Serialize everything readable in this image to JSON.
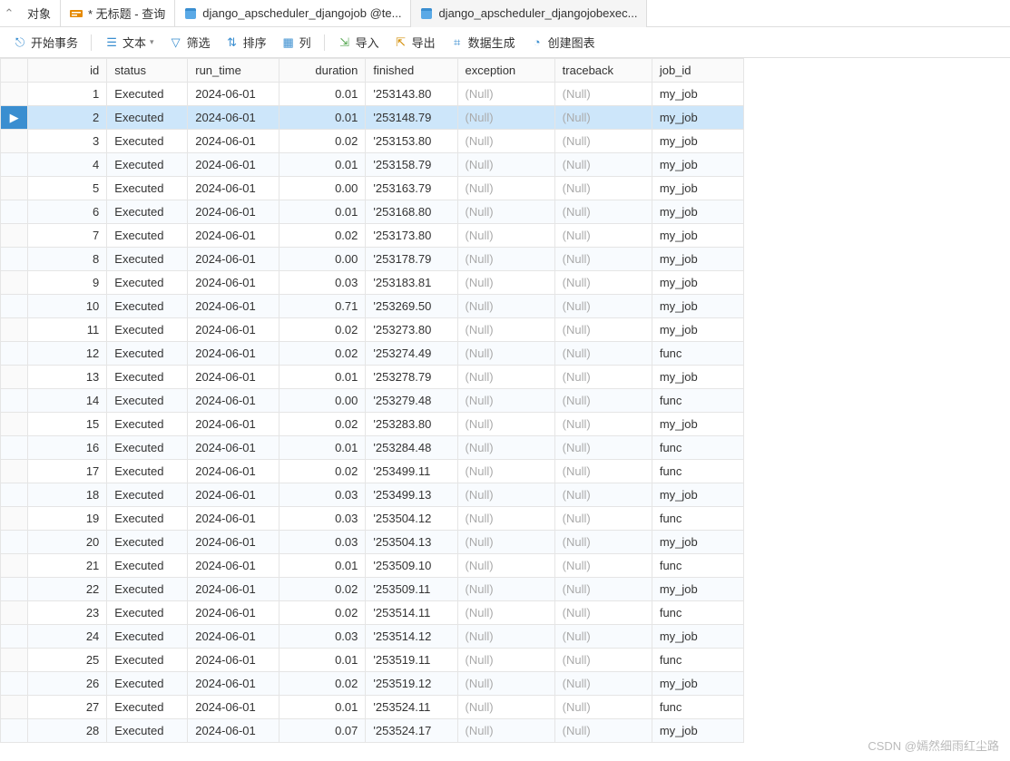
{
  "tabs": {
    "objects": "对象",
    "query": "* 无标题 - 查询",
    "t1": "django_apscheduler_djangojob @te...",
    "t2": "django_apscheduler_djangojobexec..."
  },
  "toolbar": {
    "begin_trans": "开始事务",
    "text": "文本",
    "filter": "筛选",
    "sort": "排序",
    "columns": "列",
    "import": "导入",
    "export": "导出",
    "datagen": "数据生成",
    "chart": "创建图表"
  },
  "headers": {
    "id": "id",
    "status": "status",
    "run_time": "run_time",
    "duration": "duration",
    "finished": "finished",
    "exception": "exception",
    "traceback": "traceback",
    "job_id": "job_id"
  },
  "null_label": "(Null)",
  "selected_row": 2,
  "rows": [
    {
      "id": 1,
      "status": "Executed",
      "run_time": "2024-06-01",
      "duration": "0.01",
      "finished": "'253143.80",
      "exception": null,
      "traceback": null,
      "job_id": "my_job"
    },
    {
      "id": 2,
      "status": "Executed",
      "run_time": "2024-06-01",
      "duration": "0.01",
      "finished": "'253148.79",
      "exception": null,
      "traceback": null,
      "job_id": "my_job"
    },
    {
      "id": 3,
      "status": "Executed",
      "run_time": "2024-06-01",
      "duration": "0.02",
      "finished": "'253153.80",
      "exception": null,
      "traceback": null,
      "job_id": "my_job"
    },
    {
      "id": 4,
      "status": "Executed",
      "run_time": "2024-06-01",
      "duration": "0.01",
      "finished": "'253158.79",
      "exception": null,
      "traceback": null,
      "job_id": "my_job"
    },
    {
      "id": 5,
      "status": "Executed",
      "run_time": "2024-06-01",
      "duration": "0.00",
      "finished": "'253163.79",
      "exception": null,
      "traceback": null,
      "job_id": "my_job"
    },
    {
      "id": 6,
      "status": "Executed",
      "run_time": "2024-06-01",
      "duration": "0.01",
      "finished": "'253168.80",
      "exception": null,
      "traceback": null,
      "job_id": "my_job"
    },
    {
      "id": 7,
      "status": "Executed",
      "run_time": "2024-06-01",
      "duration": "0.02",
      "finished": "'253173.80",
      "exception": null,
      "traceback": null,
      "job_id": "my_job"
    },
    {
      "id": 8,
      "status": "Executed",
      "run_time": "2024-06-01",
      "duration": "0.00",
      "finished": "'253178.79",
      "exception": null,
      "traceback": null,
      "job_id": "my_job"
    },
    {
      "id": 9,
      "status": "Executed",
      "run_time": "2024-06-01",
      "duration": "0.03",
      "finished": "'253183.81",
      "exception": null,
      "traceback": null,
      "job_id": "my_job"
    },
    {
      "id": 10,
      "status": "Executed",
      "run_time": "2024-06-01",
      "duration": "0.71",
      "finished": "'253269.50",
      "exception": null,
      "traceback": null,
      "job_id": "my_job"
    },
    {
      "id": 11,
      "status": "Executed",
      "run_time": "2024-06-01",
      "duration": "0.02",
      "finished": "'253273.80",
      "exception": null,
      "traceback": null,
      "job_id": "my_job"
    },
    {
      "id": 12,
      "status": "Executed",
      "run_time": "2024-06-01",
      "duration": "0.02",
      "finished": "'253274.49",
      "exception": null,
      "traceback": null,
      "job_id": "func"
    },
    {
      "id": 13,
      "status": "Executed",
      "run_time": "2024-06-01",
      "duration": "0.01",
      "finished": "'253278.79",
      "exception": null,
      "traceback": null,
      "job_id": "my_job"
    },
    {
      "id": 14,
      "status": "Executed",
      "run_time": "2024-06-01",
      "duration": "0.00",
      "finished": "'253279.48",
      "exception": null,
      "traceback": null,
      "job_id": "func"
    },
    {
      "id": 15,
      "status": "Executed",
      "run_time": "2024-06-01",
      "duration": "0.02",
      "finished": "'253283.80",
      "exception": null,
      "traceback": null,
      "job_id": "my_job"
    },
    {
      "id": 16,
      "status": "Executed",
      "run_time": "2024-06-01",
      "duration": "0.01",
      "finished": "'253284.48",
      "exception": null,
      "traceback": null,
      "job_id": "func"
    },
    {
      "id": 17,
      "status": "Executed",
      "run_time": "2024-06-01",
      "duration": "0.02",
      "finished": "'253499.11",
      "exception": null,
      "traceback": null,
      "job_id": "func"
    },
    {
      "id": 18,
      "status": "Executed",
      "run_time": "2024-06-01",
      "duration": "0.03",
      "finished": "'253499.13",
      "exception": null,
      "traceback": null,
      "job_id": "my_job"
    },
    {
      "id": 19,
      "status": "Executed",
      "run_time": "2024-06-01",
      "duration": "0.03",
      "finished": "'253504.12",
      "exception": null,
      "traceback": null,
      "job_id": "func"
    },
    {
      "id": 20,
      "status": "Executed",
      "run_time": "2024-06-01",
      "duration": "0.03",
      "finished": "'253504.13",
      "exception": null,
      "traceback": null,
      "job_id": "my_job"
    },
    {
      "id": 21,
      "status": "Executed",
      "run_time": "2024-06-01",
      "duration": "0.01",
      "finished": "'253509.10",
      "exception": null,
      "traceback": null,
      "job_id": "func"
    },
    {
      "id": 22,
      "status": "Executed",
      "run_time": "2024-06-01",
      "duration": "0.02",
      "finished": "'253509.11",
      "exception": null,
      "traceback": null,
      "job_id": "my_job"
    },
    {
      "id": 23,
      "status": "Executed",
      "run_time": "2024-06-01",
      "duration": "0.02",
      "finished": "'253514.11",
      "exception": null,
      "traceback": null,
      "job_id": "func"
    },
    {
      "id": 24,
      "status": "Executed",
      "run_time": "2024-06-01",
      "duration": "0.03",
      "finished": "'253514.12",
      "exception": null,
      "traceback": null,
      "job_id": "my_job"
    },
    {
      "id": 25,
      "status": "Executed",
      "run_time": "2024-06-01",
      "duration": "0.01",
      "finished": "'253519.11",
      "exception": null,
      "traceback": null,
      "job_id": "func"
    },
    {
      "id": 26,
      "status": "Executed",
      "run_time": "2024-06-01",
      "duration": "0.02",
      "finished": "'253519.12",
      "exception": null,
      "traceback": null,
      "job_id": "my_job"
    },
    {
      "id": 27,
      "status": "Executed",
      "run_time": "2024-06-01",
      "duration": "0.01",
      "finished": "'253524.11",
      "exception": null,
      "traceback": null,
      "job_id": "func"
    },
    {
      "id": 28,
      "status": "Executed",
      "run_time": "2024-06-01",
      "duration": "0.07",
      "finished": "'253524.17",
      "exception": null,
      "traceback": null,
      "job_id": "my_job"
    }
  ],
  "watermark": "CSDN @嫣然细雨红尘路"
}
